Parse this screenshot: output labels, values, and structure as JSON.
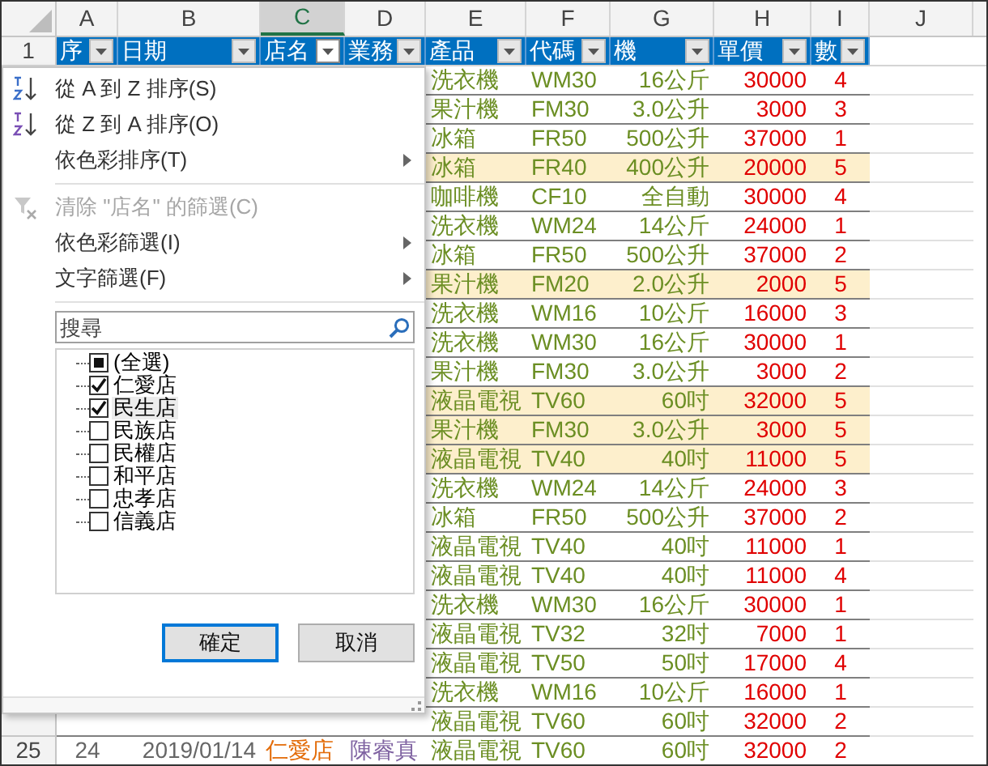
{
  "column_letters": [
    {
      "label": "A",
      "selected": false
    },
    {
      "label": "B",
      "selected": false
    },
    {
      "label": "C",
      "selected": true
    },
    {
      "label": "D",
      "selected": false
    },
    {
      "label": "E",
      "selected": false
    },
    {
      "label": "F",
      "selected": false
    },
    {
      "label": "G",
      "selected": false
    },
    {
      "label": "H",
      "selected": false
    },
    {
      "label": "I",
      "selected": false
    },
    {
      "label": "J",
      "selected": false
    }
  ],
  "header_row": {
    "row_number": "1",
    "columns": [
      {
        "label": "序",
        "open": false
      },
      {
        "label": "日期",
        "open": false
      },
      {
        "label": "店名",
        "open": true
      },
      {
        "label": "業務",
        "open": false
      },
      {
        "label": "產品",
        "open": false
      },
      {
        "label": "代碼",
        "open": false
      },
      {
        "label": "機",
        "open": false
      },
      {
        "label": "單價",
        "open": false
      },
      {
        "label": "數",
        "open": false
      }
    ]
  },
  "rows": [
    {
      "highlighted": false,
      "cells": [
        "洗衣機",
        "WM30",
        "16公斤",
        "30000",
        "4"
      ]
    },
    {
      "highlighted": false,
      "cells": [
        "果汁機",
        "FM30",
        "3.0公升",
        "3000",
        "3"
      ]
    },
    {
      "highlighted": false,
      "cells": [
        "冰箱",
        "FR50",
        "500公升",
        "37000",
        "1"
      ]
    },
    {
      "highlighted": true,
      "cells": [
        "冰箱",
        "FR40",
        "400公升",
        "20000",
        "5"
      ]
    },
    {
      "highlighted": false,
      "cells": [
        "咖啡機",
        "CF10",
        "全自動",
        "30000",
        "4"
      ]
    },
    {
      "highlighted": false,
      "cells": [
        "洗衣機",
        "WM24",
        "14公斤",
        "24000",
        "1"
      ]
    },
    {
      "highlighted": false,
      "cells": [
        "冰箱",
        "FR50",
        "500公升",
        "37000",
        "2"
      ]
    },
    {
      "highlighted": true,
      "cells": [
        "果汁機",
        "FM20",
        "2.0公升",
        "2000",
        "5"
      ]
    },
    {
      "highlighted": false,
      "cells": [
        "洗衣機",
        "WM16",
        "10公斤",
        "16000",
        "3"
      ]
    },
    {
      "highlighted": false,
      "cells": [
        "洗衣機",
        "WM30",
        "16公斤",
        "30000",
        "1"
      ]
    },
    {
      "highlighted": false,
      "cells": [
        "果汁機",
        "FM30",
        "3.0公升",
        "3000",
        "2"
      ]
    },
    {
      "highlighted": true,
      "cells": [
        "液晶電視",
        "TV60",
        "60吋",
        "32000",
        "5"
      ]
    },
    {
      "highlighted": true,
      "cells": [
        "果汁機",
        "FM30",
        "3.0公升",
        "3000",
        "5"
      ]
    },
    {
      "highlighted": true,
      "cells": [
        "液晶電視",
        "TV40",
        "40吋",
        "11000",
        "5"
      ]
    },
    {
      "highlighted": false,
      "cells": [
        "洗衣機",
        "WM24",
        "14公斤",
        "24000",
        "3"
      ]
    },
    {
      "highlighted": false,
      "cells": [
        "冰箱",
        "FR50",
        "500公升",
        "37000",
        "2"
      ]
    },
    {
      "highlighted": false,
      "cells": [
        "液晶電視",
        "TV40",
        "40吋",
        "11000",
        "1"
      ]
    },
    {
      "highlighted": false,
      "cells": [
        "液晶電視",
        "TV40",
        "40吋",
        "11000",
        "4"
      ]
    },
    {
      "highlighted": false,
      "cells": [
        "洗衣機",
        "WM30",
        "16公斤",
        "30000",
        "1"
      ]
    },
    {
      "highlighted": false,
      "cells": [
        "液晶電視",
        "TV32",
        "32吋",
        "7000",
        "1"
      ]
    },
    {
      "highlighted": false,
      "cells": [
        "液晶電視",
        "TV50",
        "50吋",
        "17000",
        "4"
      ]
    },
    {
      "highlighted": false,
      "cells": [
        "洗衣機",
        "WM16",
        "10公斤",
        "16000",
        "1"
      ]
    },
    {
      "highlighted": false,
      "cells": [
        "液晶電視",
        "TV60",
        "60吋",
        "32000",
        "2"
      ]
    },
    {
      "row_number": "25",
      "highlighted": false,
      "cells": [
        "24",
        "2019/01/14",
        "仁愛店",
        "陳睿真",
        "液晶電視",
        "TV60",
        "60吋",
        "32000",
        "2"
      ]
    }
  ],
  "filter_menu": {
    "items": [
      {
        "kind": "sort_asc",
        "label": "從 A 到 Z 排序(S)",
        "disabled": false
      },
      {
        "kind": "sort_desc",
        "label": "從 Z 到 A 排序(O)",
        "disabled": false
      },
      {
        "kind": "submenu",
        "label": "依色彩排序(T)",
        "disabled": false
      },
      {
        "kind": "clear",
        "label": "清除 \"店名\" 的篩選(C)",
        "disabled": true
      },
      {
        "kind": "submenu",
        "label": "依色彩篩選(I)",
        "disabled": false
      },
      {
        "kind": "submenu",
        "label": "文字篩選(F)",
        "disabled": false
      }
    ],
    "search": {
      "placeholder": "搜尋"
    },
    "values": [
      {
        "kind": "select_all",
        "label": "(全選)",
        "checked": false,
        "hovered": false
      },
      {
        "kind": "value",
        "label": "仁愛店",
        "checked": true,
        "hovered": false
      },
      {
        "kind": "value",
        "label": "民生店",
        "checked": true,
        "hovered": true
      },
      {
        "kind": "value",
        "label": "民族店",
        "checked": false,
        "hovered": false
      },
      {
        "kind": "value",
        "label": "民權店",
        "checked": false,
        "hovered": false
      },
      {
        "kind": "value",
        "label": "和平店",
        "checked": false,
        "hovered": false
      },
      {
        "kind": "value",
        "label": "忠孝店",
        "checked": false,
        "hovered": false
      },
      {
        "kind": "value",
        "label": "信義店",
        "checked": false,
        "hovered": false
      }
    ],
    "buttons": [
      {
        "label": "確定",
        "default": true
      },
      {
        "label": "取消",
        "default": false
      }
    ]
  }
}
